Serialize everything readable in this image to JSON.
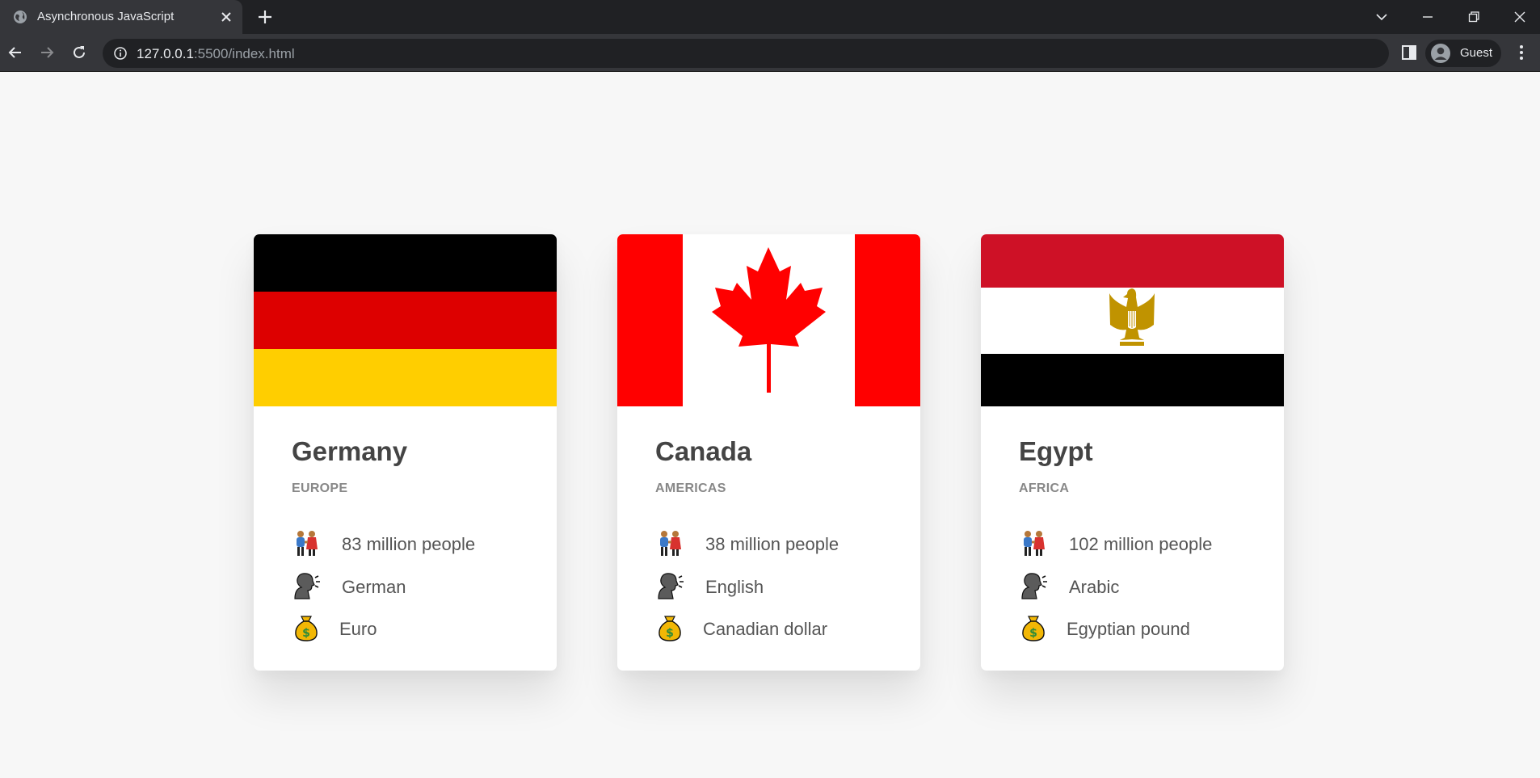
{
  "browser": {
    "tab_title": "Asynchronous JavaScript",
    "url_host": "127.0.0.1",
    "url_rest": ":5500/index.html",
    "profile_label": "Guest"
  },
  "countries": [
    {
      "name": "Germany",
      "region": "EUROPE",
      "population": "83 million people",
      "language": "German",
      "currency": "Euro",
      "flag_colors": [
        "#000000",
        "#dd0000",
        "#ffce00"
      ]
    },
    {
      "name": "Canada",
      "region": "AMERICAS",
      "population": "38 million people",
      "language": "English",
      "currency": "Canadian dollar",
      "flag_colors": [
        "#ff0000",
        "#ffffff"
      ]
    },
    {
      "name": "Egypt",
      "region": "AFRICA",
      "population": "102 million people",
      "language": "Arabic",
      "currency": "Egyptian pound",
      "flag_colors": [
        "#ce1126",
        "#ffffff",
        "#000000",
        "#c09300"
      ]
    }
  ],
  "icons": {
    "population": "people-holding-hands-icon",
    "language": "speaking-head-icon",
    "currency": "money-bag-icon"
  }
}
